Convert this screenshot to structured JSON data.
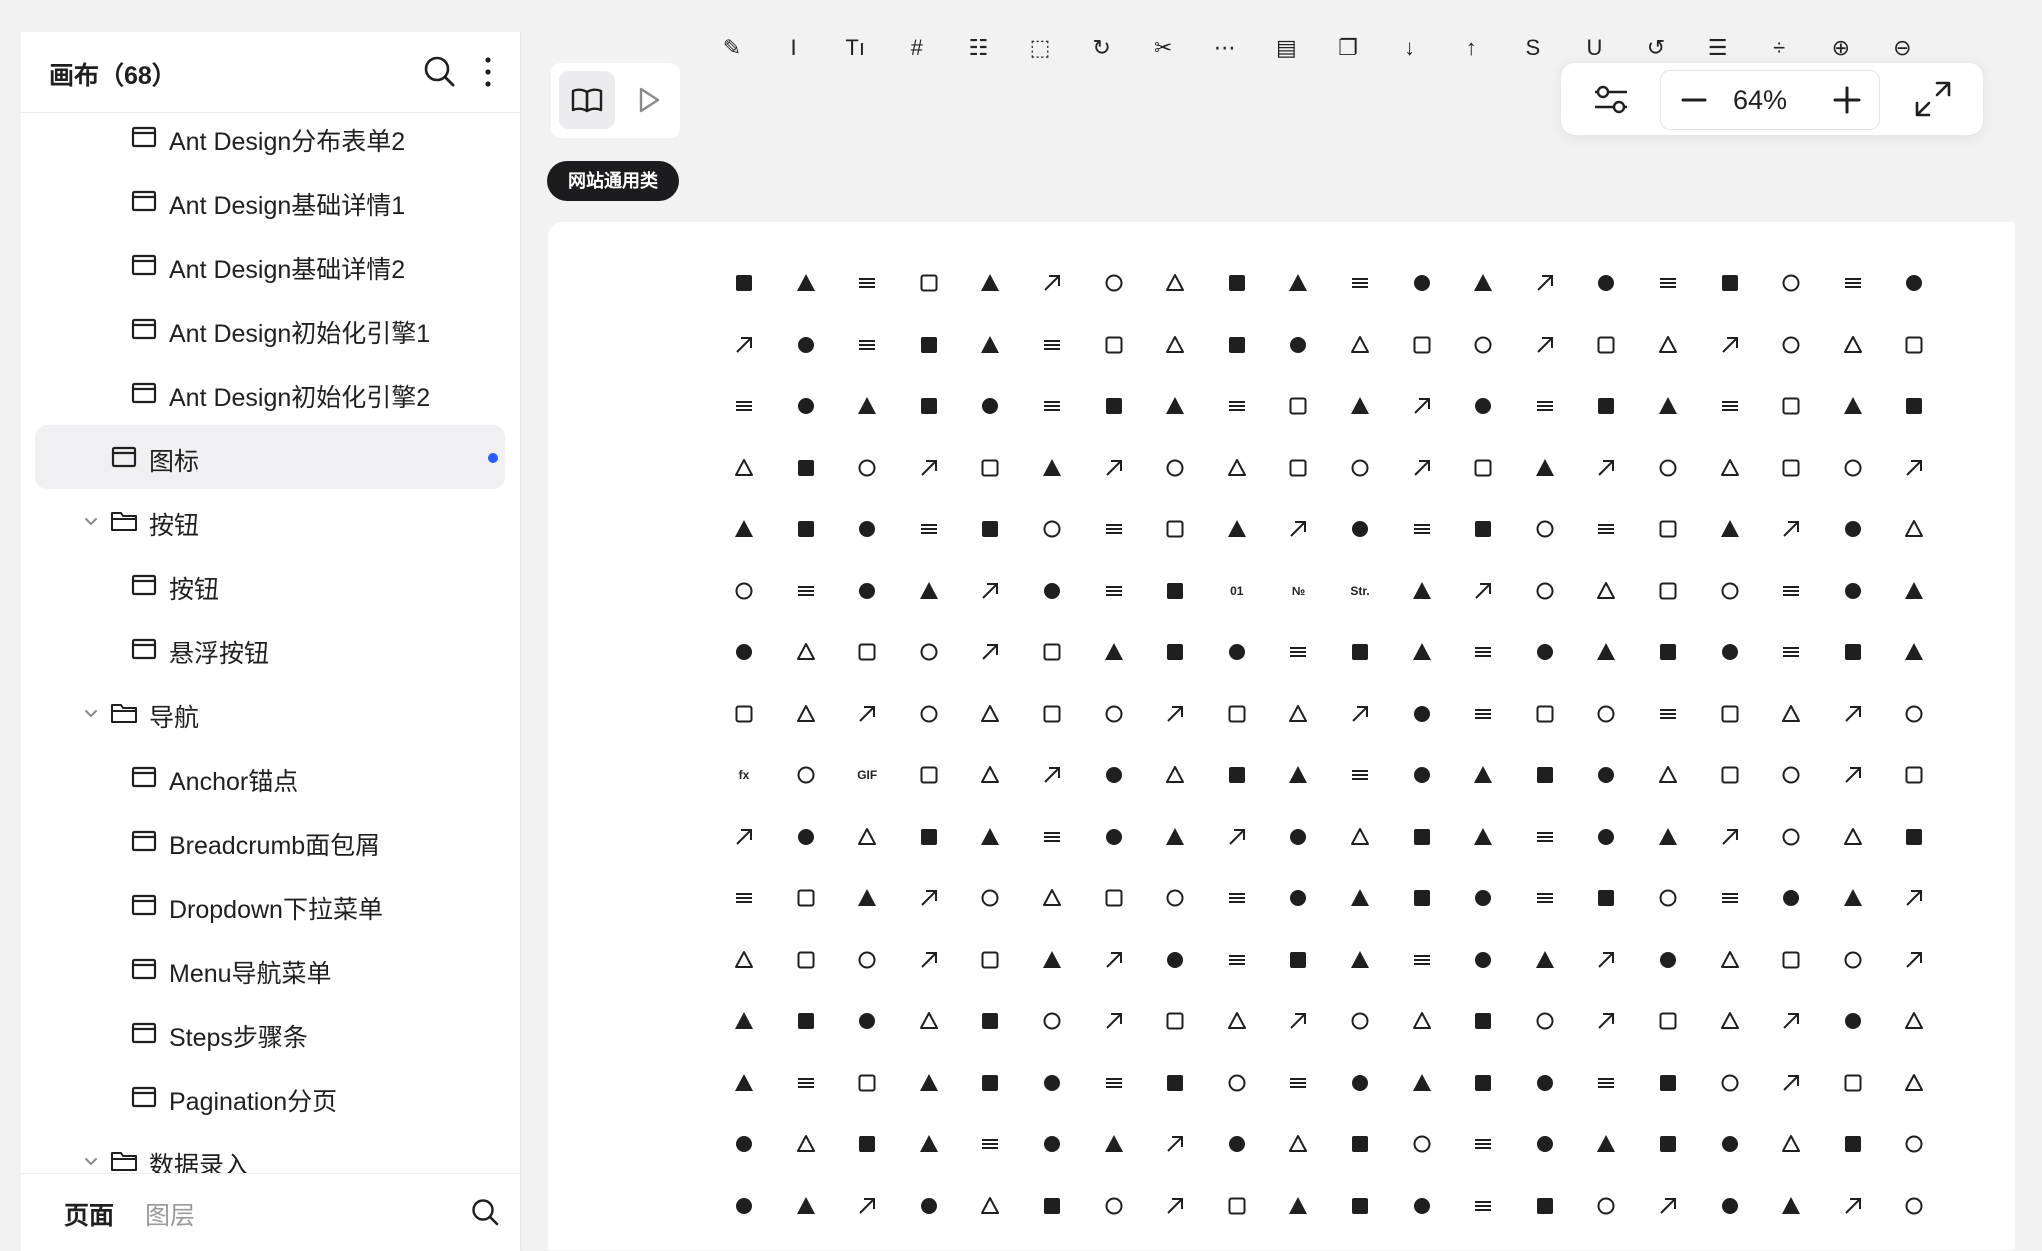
{
  "sidebar": {
    "title": "画布（68）",
    "tree": [
      {
        "label": "Ant Design分布表单2",
        "type": "page",
        "level": 2
      },
      {
        "label": "Ant Design基础详情1",
        "type": "page",
        "level": 2
      },
      {
        "label": "Ant Design基础详情2",
        "type": "page",
        "level": 2
      },
      {
        "label": "Ant Design初始化引擎1",
        "type": "page",
        "level": 2
      },
      {
        "label": "Ant Design初始化引擎2",
        "type": "page",
        "level": 2
      },
      {
        "label": "图标",
        "type": "page",
        "level": 1,
        "active": true
      },
      {
        "label": "按钮",
        "type": "folder",
        "level": 1,
        "expanded": true
      },
      {
        "label": "按钮",
        "type": "page",
        "level": 2
      },
      {
        "label": "悬浮按钮",
        "type": "page",
        "level": 2
      },
      {
        "label": "导航",
        "type": "folder",
        "level": 1,
        "expanded": true
      },
      {
        "label": "Anchor锚点",
        "type": "page",
        "level": 2
      },
      {
        "label": "Breadcrumb面包屑",
        "type": "page",
        "level": 2
      },
      {
        "label": "Dropdown下拉菜单",
        "type": "page",
        "level": 2
      },
      {
        "label": "Menu导航菜单",
        "type": "page",
        "level": 2
      },
      {
        "label": "Steps步骤条",
        "type": "page",
        "level": 2
      },
      {
        "label": "Pagination分页",
        "type": "page",
        "level": 2
      },
      {
        "label": "数据录入",
        "type": "folder",
        "level": 1,
        "expanded": true
      }
    ],
    "footer": {
      "tab_pages": "页面",
      "tab_layers": "图层",
      "active_tab": "页面"
    }
  },
  "zoom": {
    "level": "64%"
  },
  "section_tag": "网站通用类",
  "colors": {
    "accent_dot": "#2b5cff",
    "tag_bg": "#1c1c1e",
    "active_row_bg": "#f0f0f2"
  },
  "toolbar_icons": [
    "highlight-icon",
    "italic-icon",
    "font-size-icon",
    "number-icon",
    "ordered-list-icon",
    "select-icon",
    "redo-icon",
    "scissor-icon",
    "line-icon",
    "snippets-icon",
    "copy-icon",
    "sort-ascending-icon",
    "sort-descending-icon",
    "strikethrough-icon",
    "underline-icon",
    "undo-icon",
    "unordered-list-icon",
    "column-height-icon",
    "zoom-in-icon",
    "zoom-out-icon"
  ],
  "icon_grid": {
    "rows": [
      [
        "account-book",
        "account-book-outlined",
        "aim-user",
        "user",
        "aim",
        "alert",
        "alert-outlined",
        "apartment",
        "api",
        "api-outlined",
        "appstore",
        "appstore-outlined",
        "appstore-add",
        "paper-clip",
        "audio",
        "audio-outlined",
        "audio-muted",
        "audit",
        "bank",
        "bank-outlined"
      ],
      [
        "barcode",
        "block",
        "block-outlined",
        "bell",
        "bell-outlined",
        "border",
        "book",
        "book-outlined",
        "border-outlined",
        "branches",
        "bug",
        "bug-outlined",
        "build",
        "build-outlined",
        "bulb",
        "bulb-outlined",
        "calculator",
        "calculator-outlined",
        "calendar-check",
        "calendar-outlined"
      ],
      [
        "calendar",
        "calendar-outlined-2",
        "camera",
        "camera-outlined",
        "car",
        "car-outlined",
        "carry-out",
        "carry-out-outlined",
        "ci-circle",
        "ci",
        "cloud-server",
        "cloud-download",
        "cloud",
        "cloud-outlined",
        "cloud-sync",
        "cloud-sync-outlined",
        "cloud-upload",
        "cluster",
        "code",
        "code-outlined"
      ],
      [
        "menu-unfold",
        "comment",
        "compass",
        "compass-outlined",
        "compress",
        "fund-projection",
        "contacts",
        "contacts-outlined",
        "container",
        "container-outlined",
        "control",
        "control-outlined",
        "copyright-circle",
        "copyright",
        "credit-card",
        "credit-card-outlined",
        "crown",
        "crown-outlined",
        "customer-service",
        "customer-service-outlined"
      ],
      [
        "dashboard",
        "dashboard-outlined",
        "database",
        "database-outlined",
        "deployment-unit",
        "delete-column",
        "aim-user-2",
        "user-2",
        "deployment",
        "desktop",
        "diff",
        "diff-outlined",
        "disconnect",
        "dollar-circle",
        "dollar",
        "download",
        "global",
        "euro-circle",
        "euro",
        "menu-fold"
      ],
      [
        "expand",
        "experiment",
        "experiment-outlined",
        "export",
        "eye-invisible",
        "eye",
        "eye-outlined",
        "eye-invisible-filled",
        "field-binary",
        "field-number",
        "field-string",
        "field-time",
        "file-add",
        "file-add-outlined",
        "file-excel",
        "file-excel-outlined",
        "file-exclamation",
        "file",
        "file-outlined",
        "file-filled"
      ],
      [
        "file-image",
        "file-markdown",
        "file-markdown-outlined",
        "file-pdf",
        "file-pdf-outlined",
        "file-blank",
        "file-ppt",
        "file-ppt-outlined",
        "file-protect",
        "file-protect-outlined",
        "file-text",
        "file-text-outlined",
        "file-unknown",
        "file-unknown-outlined",
        "file-word",
        "file-word-outlined",
        "file-zip",
        "file-zip-outlined",
        "file-search",
        "file-search-outlined"
      ],
      [
        "file-search-2",
        "file-search-outlined-2",
        "filter",
        "filter-outlined",
        "fire",
        "fire-outlined",
        "flag",
        "flag-outlined",
        "folder-add",
        "folder-add-outlined",
        "folder",
        "folder-open",
        "folder-open-outlined",
        "folder-outlined",
        "folder-view",
        "fork",
        "format-painter",
        "format-painter-outlined",
        "frown",
        "frown-outlined"
      ],
      [
        "function",
        "fullscreen",
        "gif",
        "gift",
        "gift-outlined",
        "gold",
        "gold-filled",
        "group",
        "heart",
        "heart-outlined",
        "home",
        "home-outlined",
        "hourglass",
        "hourglass-outlined",
        "idcard",
        "idcard-filled",
        "idcard-outlined",
        "picture",
        "picture-outlined",
        "form"
      ],
      [
        "interaction",
        "table",
        "insert-row",
        "insert-column",
        "insert-column-outlined",
        "insurance",
        "insurance-outlined",
        "interaction-filled",
        "layout-form",
        "search",
        "laptop",
        "layout",
        "layout-outlined",
        "like",
        "like-outlined",
        "link",
        "environment",
        "environment-outlined",
        "lock",
        "unlock"
      ],
      [
        "mail",
        "border-rect",
        "man",
        "medicine-box",
        "medicine-box-outlined",
        "meh",
        "meh-outlined",
        "merge-cells",
        "message",
        "message-outlined",
        "mobile",
        "mobile-outlined",
        "money-collect",
        "money-collect-outlined",
        "monitor",
        "node-index",
        "notification",
        "notification-outlined",
        "partition",
        "percentage"
      ],
      [
        "phone",
        "phone-outlined",
        "play-square",
        "play-square-outlined",
        "pound-circle",
        "pound",
        "poweroff",
        "printer",
        "printer-outlined",
        "project",
        "project-outlined",
        "property-safety",
        "property-safety-outlined",
        "pushpin",
        "pushpin-filled",
        "qrcode",
        "read",
        "read-outlined",
        "reconciliation",
        "reconciliation-outlined"
      ],
      [
        "red-envelope",
        "red-envelope-outlined",
        "reload",
        "history",
        "fund",
        "rest",
        "rest-outlined",
        "robot",
        "robot-outlined",
        "rocket",
        "rocket-outlined",
        "rotate-left",
        "rotate-right",
        "safety-certificate",
        "safety-certificate-outlined",
        "save",
        "save-outlined",
        "scan",
        "zoom",
        "security-scan"
      ],
      [
        "security-scan-outlined",
        "select-cursor",
        "send",
        "setting",
        "setting-outlined",
        "hdd",
        "hdd-outlined",
        "tag-diamond",
        "share-alt",
        "shop",
        "shop-outlined",
        "shopping",
        "shopping-outlined",
        "command",
        "command-outlined",
        "sisternode",
        "skin",
        "skin-outlined",
        "smile",
        "smile-outlined"
      ],
      [
        "split-cells",
        "solution",
        "sound",
        "sound-outlined",
        "star",
        "star-outlined",
        "switcher",
        "key",
        "usergroup-add",
        "sync",
        "table-2",
        "number-2",
        "tablet",
        "tablet-outlined",
        "tag",
        "tag-outlined",
        "tags",
        "tags-filled",
        "team",
        "thunderbolt"
      ],
      [
        "thunderbolt-outlined",
        "vertical-align-top",
        "registered-circle",
        "registered",
        "trademark-circle",
        "trophy-project",
        "trophy",
        "trophy-outlined",
        "border-inner",
        "dislike",
        "dislike-outlined",
        "unlock-filled",
        "unlock-outlined",
        "upload",
        "usb",
        "usb-outlined",
        "user-outlined",
        "verified",
        "video-camera",
        "video-camera-outlined"
      ]
    ]
  }
}
